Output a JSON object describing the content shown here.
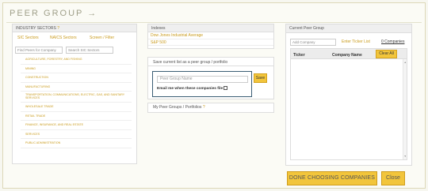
{
  "header": {
    "title": "PEER GROUP →"
  },
  "industry": {
    "header": "INDUSTRY SECTORS",
    "help": "?",
    "tabs": [
      "SIC Sectors",
      "NAICS Sectors",
      "Screen / Filter"
    ],
    "find_placeholder": "Find Peers for Company",
    "search_placeholder": "Search SIC Sectors",
    "sectors": [
      "AGRICULTURE, FORESTRY, AND FISHING",
      "MINING",
      "CONSTRUCTION",
      "MANUFACTURING",
      "TRANSPORTATION, COMMUNICATIONS, ELECTRIC, GAS, AND SANITARY SERVICES",
      "WHOLESALE TRADE",
      "RETAIL TRADE",
      "FINANCE, INSURANCE, AND REAL ESTATE",
      "SERVICES",
      "PUBLIC ADMINISTRATION"
    ]
  },
  "indexes": {
    "header": "Indexes",
    "items": [
      "Dow Jones Industrial Average",
      "S&P 500"
    ]
  },
  "save": {
    "label": "Save current list as a peer group / portfolio",
    "name_placeholder": "Peer Group Name",
    "email_label": "Email me when these companies file",
    "button": "Save"
  },
  "my_groups": {
    "label": "My Peer Groups / Portfolios",
    "help": "?"
  },
  "current": {
    "header": "Current Peer Group",
    "add_placeholder": "Add Company",
    "enter_link": "Enter Ticker List",
    "count": "0 Companies",
    "columns": [
      "Ticker",
      "Company Name"
    ],
    "clear": "Clear All"
  },
  "footer": {
    "done": "DONE CHOOSING COMPANIES",
    "close": "Close"
  },
  "colors": {
    "accent": "#f2c53b",
    "link": "#c99a1a",
    "focus": "#3a5d74"
  }
}
